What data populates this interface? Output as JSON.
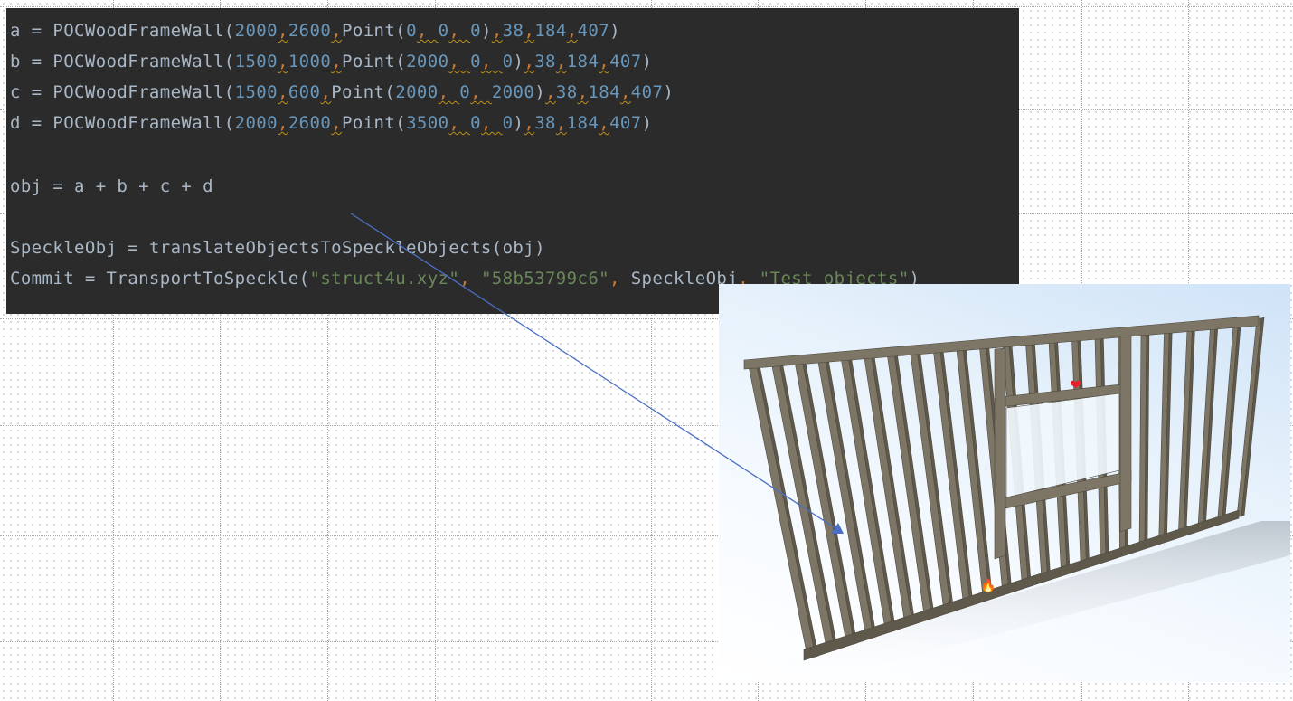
{
  "code_editor": {
    "lines": [
      {
        "id": "a",
        "tokens": [
          {
            "t": "a = POCWoodFrameWall(",
            "c": "txt"
          },
          {
            "t": "2000",
            "c": "num"
          },
          {
            "t": ",",
            "c": "sep"
          },
          {
            "t": "2600",
            "c": "num"
          },
          {
            "t": ",",
            "c": "sep"
          },
          {
            "t": "Point(",
            "c": "txt"
          },
          {
            "t": "0",
            "c": "num"
          },
          {
            "t": ", ",
            "c": "sep"
          },
          {
            "t": "0",
            "c": "num"
          },
          {
            "t": ", ",
            "c": "sep"
          },
          {
            "t": "0",
            "c": "num"
          },
          {
            "t": ")",
            "c": "txt"
          },
          {
            "t": ",",
            "c": "sep"
          },
          {
            "t": "38",
            "c": "num"
          },
          {
            "t": ",",
            "c": "sep"
          },
          {
            "t": "184",
            "c": "num"
          },
          {
            "t": ",",
            "c": "sep"
          },
          {
            "t": "407",
            "c": "num"
          },
          {
            "t": ")",
            "c": "txt"
          }
        ]
      },
      {
        "id": "b",
        "tokens": [
          {
            "t": "b = POCWoodFrameWall(",
            "c": "txt"
          },
          {
            "t": "1500",
            "c": "num"
          },
          {
            "t": ",",
            "c": "sep"
          },
          {
            "t": "1000",
            "c": "num"
          },
          {
            "t": ",",
            "c": "sep"
          },
          {
            "t": "Point(",
            "c": "txt"
          },
          {
            "t": "2000",
            "c": "num"
          },
          {
            "t": ", ",
            "c": "sep"
          },
          {
            "t": "0",
            "c": "num"
          },
          {
            "t": ", ",
            "c": "sep"
          },
          {
            "t": "0",
            "c": "num"
          },
          {
            "t": ")",
            "c": "txt"
          },
          {
            "t": ",",
            "c": "sep"
          },
          {
            "t": "38",
            "c": "num"
          },
          {
            "t": ",",
            "c": "sep"
          },
          {
            "t": "184",
            "c": "num"
          },
          {
            "t": ",",
            "c": "sep"
          },
          {
            "t": "407",
            "c": "num"
          },
          {
            "t": ")",
            "c": "txt"
          }
        ]
      },
      {
        "id": "c",
        "tokens": [
          {
            "t": "c = POCWoodFrameWall(",
            "c": "txt"
          },
          {
            "t": "1500",
            "c": "num"
          },
          {
            "t": ",",
            "c": "sep"
          },
          {
            "t": "600",
            "c": "num"
          },
          {
            "t": ",",
            "c": "sep"
          },
          {
            "t": "Point(",
            "c": "txt"
          },
          {
            "t": "2000",
            "c": "num"
          },
          {
            "t": ", ",
            "c": "sep"
          },
          {
            "t": "0",
            "c": "num"
          },
          {
            "t": ", ",
            "c": "sep"
          },
          {
            "t": "2000",
            "c": "num"
          },
          {
            "t": ")",
            "c": "txt"
          },
          {
            "t": ",",
            "c": "sep"
          },
          {
            "t": "38",
            "c": "num"
          },
          {
            "t": ",",
            "c": "sep"
          },
          {
            "t": "184",
            "c": "num"
          },
          {
            "t": ",",
            "c": "sep"
          },
          {
            "t": "407",
            "c": "num"
          },
          {
            "t": ")",
            "c": "txt"
          }
        ]
      },
      {
        "id": "d",
        "tokens": [
          {
            "t": "d = POCWoodFrameWall(",
            "c": "txt"
          },
          {
            "t": "2000",
            "c": "num"
          },
          {
            "t": ",",
            "c": "sep"
          },
          {
            "t": "2600",
            "c": "num"
          },
          {
            "t": ",",
            "c": "sep"
          },
          {
            "t": "Point(",
            "c": "txt"
          },
          {
            "t": "3500",
            "c": "num"
          },
          {
            "t": ", ",
            "c": "sep"
          },
          {
            "t": "0",
            "c": "num"
          },
          {
            "t": ", ",
            "c": "sep"
          },
          {
            "t": "0",
            "c": "num"
          },
          {
            "t": ")",
            "c": "txt"
          },
          {
            "t": ",",
            "c": "sep"
          },
          {
            "t": "38",
            "c": "num"
          },
          {
            "t": ",",
            "c": "sep"
          },
          {
            "t": "184",
            "c": "num"
          },
          {
            "t": ",",
            "c": "sep"
          },
          {
            "t": "407",
            "c": "num"
          },
          {
            "t": ")",
            "c": "txt"
          }
        ]
      },
      {
        "id": "obj",
        "tokens": [
          {
            "t": "obj = a + b + c + d",
            "c": "txt"
          }
        ]
      },
      {
        "id": "speckleobj",
        "tokens": [
          {
            "t": "SpeckleObj = translateObjectsToSpeckleObjects(obj)",
            "c": "txt"
          }
        ]
      },
      {
        "id": "commit",
        "tokens": [
          {
            "t": "Commit = TransportToSpeckle(",
            "c": "txt"
          },
          {
            "t": "\"struct4u.xyz\"",
            "c": "str"
          },
          {
            "t": ", ",
            "c": "sep"
          },
          {
            "t": "\"58b53799c6\"",
            "c": "str"
          },
          {
            "t": ", ",
            "c": "sep"
          },
          {
            "t": "SpeckleObj",
            "c": "txt"
          },
          {
            "t": ", ",
            "c": "sep"
          },
          {
            "t": "\"Test objects\"",
            "c": "str"
          },
          {
            "t": ")",
            "c": "txt"
          }
        ]
      }
    ]
  },
  "viewer": {
    "frame_color": "#7d7666",
    "frame_shade": "#5f594c",
    "markers": [
      {
        "name": "heart-marker-icon",
        "glyph": "❤",
        "color": "#e0232e"
      },
      {
        "name": "flame-marker-icon",
        "glyph": "🔥",
        "color": "#f08a1c"
      }
    ]
  },
  "arrow": {
    "color": "#4a6fc4"
  },
  "colors": {
    "editor_bg": "#2b2b2b",
    "editor_text": "#a9b7c6",
    "number": "#6897bb",
    "string": "#6a8759",
    "separator": "#cc7832"
  }
}
